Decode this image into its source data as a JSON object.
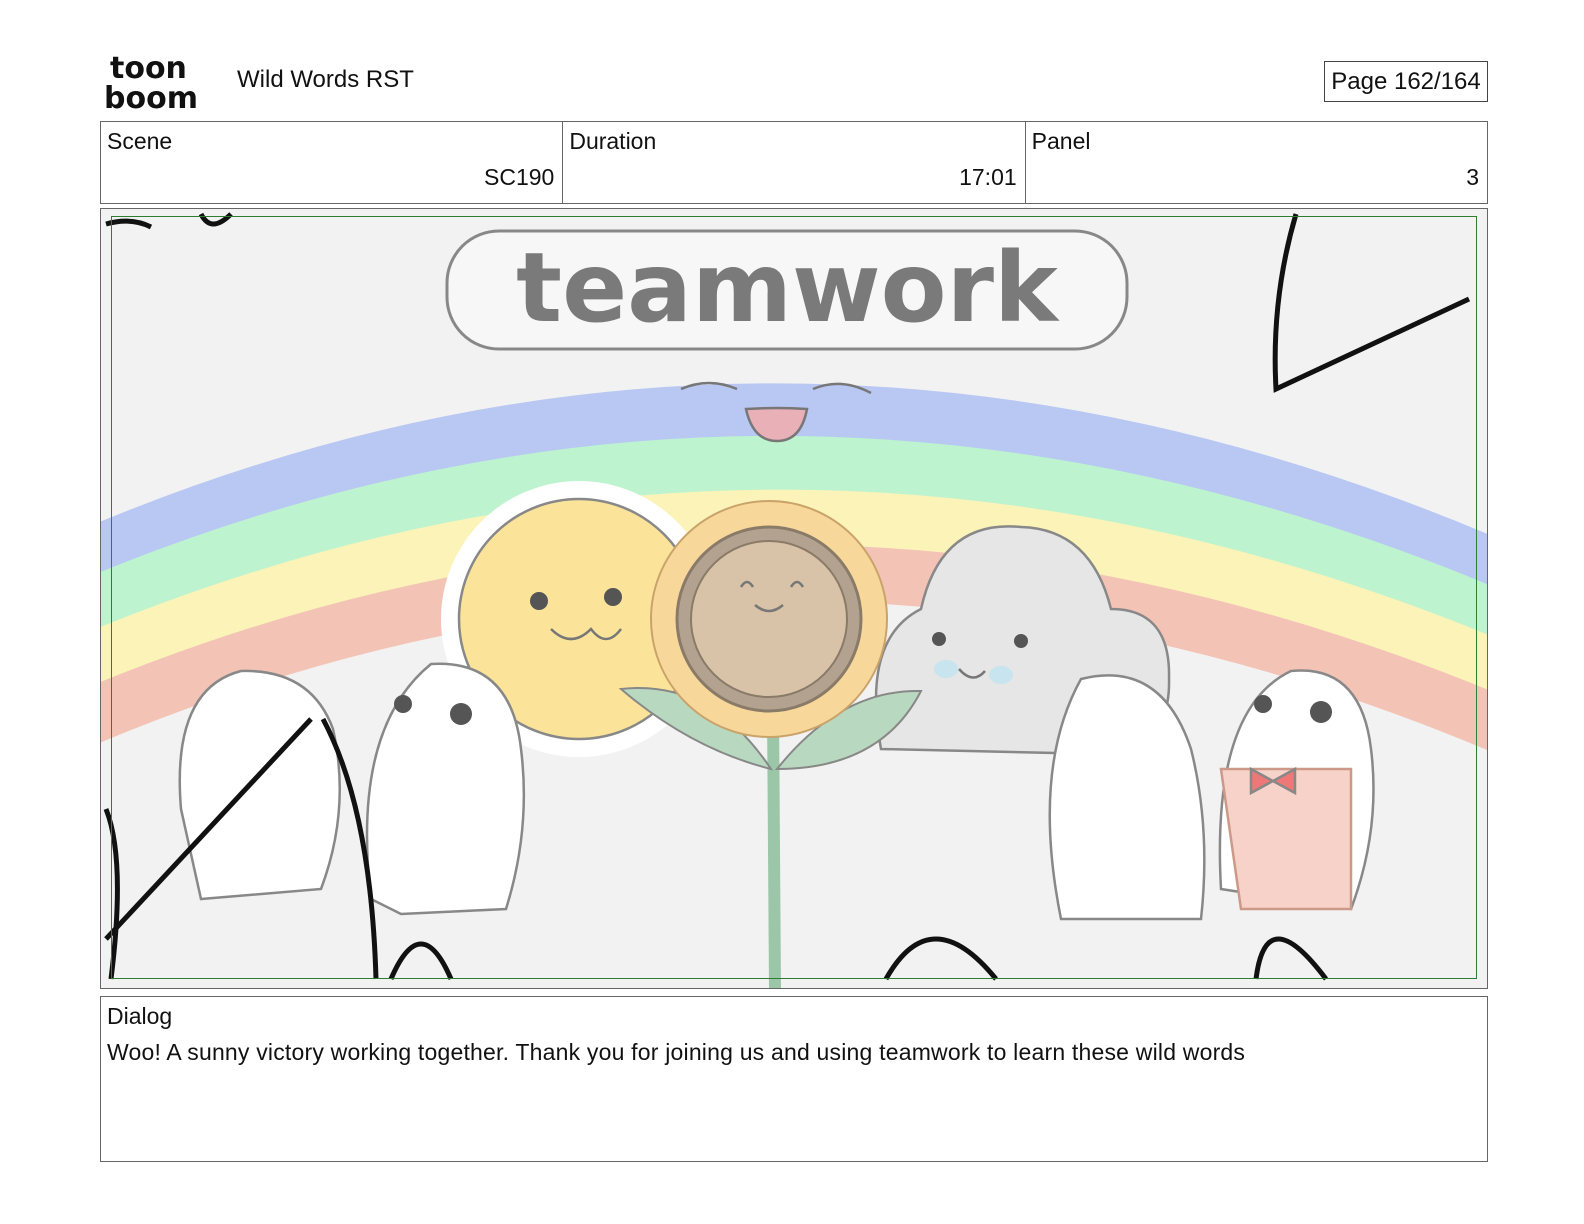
{
  "header": {
    "logo_text_top": "toon",
    "logo_text_bottom": "boom",
    "project_title": "Wild Words RST",
    "page_indicator": "Page 162/164"
  },
  "info": {
    "scene_label": "Scene",
    "scene_value": "SC190",
    "duration_label": "Duration",
    "duration_value": "17:01",
    "panel_label": "Panel",
    "panel_value": "3"
  },
  "panel_image": {
    "banner_text": "teamwork",
    "colors": {
      "blue_band": "#b8c8f3",
      "green_band": "#bdf3cf",
      "yellow_band": "#fbf3b8",
      "red_band": "#f3c4b6",
      "sun": "#fbe49a",
      "sunflower_petals": "#f8d79a",
      "sunflower_face": "#d8c3a8",
      "cloud": "#e6e6e6",
      "leaf": "#b8d9c0",
      "safe_frame": "#2e7d32"
    }
  },
  "dialog": {
    "label": "Dialog",
    "text": "Woo! A sunny victory working together. Thank you for joining us and using teamwork to learn these wild words"
  }
}
